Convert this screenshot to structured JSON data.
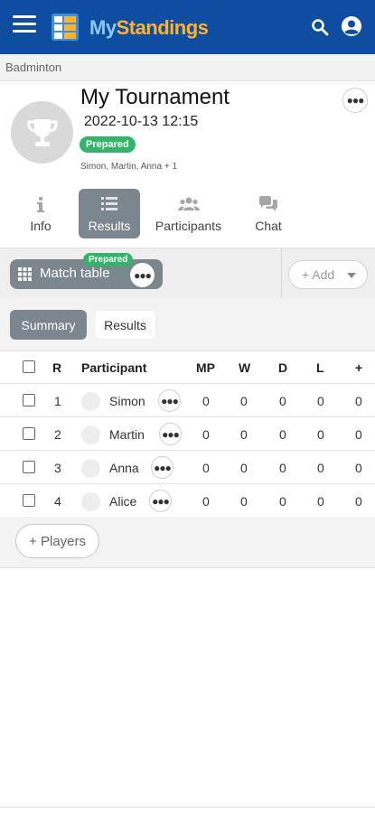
{
  "appbar": {
    "brand_my": "My",
    "brand_standings": "Standings",
    "bg": "#0f4da1",
    "brand_accent": "#ffb22d"
  },
  "category": "Badminton",
  "tournament": {
    "title": "My Tournament",
    "datetime": "2022-10-13 12:15",
    "status": "Prepared",
    "players_summary": "Simon, Martin, Anna + 1"
  },
  "tabs": [
    {
      "label": "Info",
      "icon": "info-icon",
      "active": false
    },
    {
      "label": "Results",
      "icon": "list-icon",
      "active": true
    },
    {
      "label": "Participants",
      "icon": "people-icon",
      "active": false
    },
    {
      "label": "Chat",
      "icon": "chat-icon",
      "active": false
    }
  ],
  "toolbar": {
    "match_table_label": "Match table",
    "match_table_status": "Prepared",
    "add_label": "+ Add"
  },
  "subtabs": {
    "summary": "Summary",
    "results": "Results"
  },
  "table": {
    "headers": {
      "rank": "R",
      "participant": "Participant",
      "mp": "MP",
      "w": "W",
      "d": "D",
      "l": "L",
      "plus": "+"
    },
    "rows": [
      {
        "rank": "1",
        "name": "Simon",
        "mp": "0",
        "w": "0",
        "d": "0",
        "l": "0",
        "plus": "0"
      },
      {
        "rank": "2",
        "name": "Martin",
        "mp": "0",
        "w": "0",
        "d": "0",
        "l": "0",
        "plus": "0"
      },
      {
        "rank": "3",
        "name": "Anna",
        "mp": "0",
        "w": "0",
        "d": "0",
        "l": "0",
        "plus": "0"
      },
      {
        "rank": "4",
        "name": "Alice",
        "mp": "0",
        "w": "0",
        "d": "0",
        "l": "0",
        "plus": "0"
      }
    ]
  },
  "add_players_label": "+ Players"
}
